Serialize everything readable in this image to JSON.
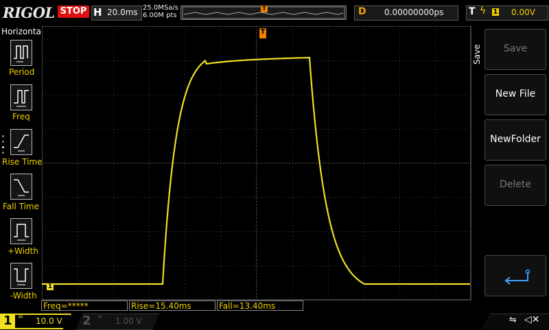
{
  "topbar": {
    "brand": "RIGOL",
    "run_state": "STOP",
    "horizontal_letter": "H",
    "time_per_div": "20.0ms",
    "sample_rate": "25.0MSa/s",
    "memory_depth": "6.00M pts",
    "trigger_marker": "T",
    "delay_letter": "D",
    "delay_value": "0.00000000ps",
    "trigger_letter": "T",
    "trigger_source": "1",
    "trigger_level": "0.00V"
  },
  "left_menu": {
    "title": "Horizontal",
    "items": [
      {
        "label": "Period",
        "icon": "period-icon"
      },
      {
        "label": "Freq",
        "icon": "freq-icon"
      },
      {
        "label": "Rise Time",
        "icon": "rise-time-icon"
      },
      {
        "label": "Fall Time",
        "icon": "fall-time-icon"
      },
      {
        "label": "+Width",
        "icon": "positive-width-icon"
      },
      {
        "label": "-Width",
        "icon": "negative-width-icon"
      }
    ]
  },
  "right_menu": {
    "title": "Save",
    "items": [
      {
        "label": "Save",
        "enabled": false
      },
      {
        "label": "New File",
        "enabled": true
      },
      {
        "label": "NewFolder",
        "enabled": true
      },
      {
        "label": "Delete",
        "enabled": false
      }
    ],
    "enter_icon": "enter-arrow-icon"
  },
  "screen": {
    "trigger_top_marker": "T",
    "channel1_marker": "1",
    "trigger_level_marker": "T"
  },
  "measurements": {
    "freq": "Freq=*****",
    "rise": "Rise=15.40ms",
    "fall": "Fall=13.40ms"
  },
  "channels": {
    "ch1_label": "1",
    "ch1_scale": "10.0 V",
    "ch2_label": "2",
    "ch2_scale": "1.00 V"
  },
  "colors": {
    "ch1": "#f0e020",
    "accent": "#f0a000",
    "stop": "#e01010"
  }
}
